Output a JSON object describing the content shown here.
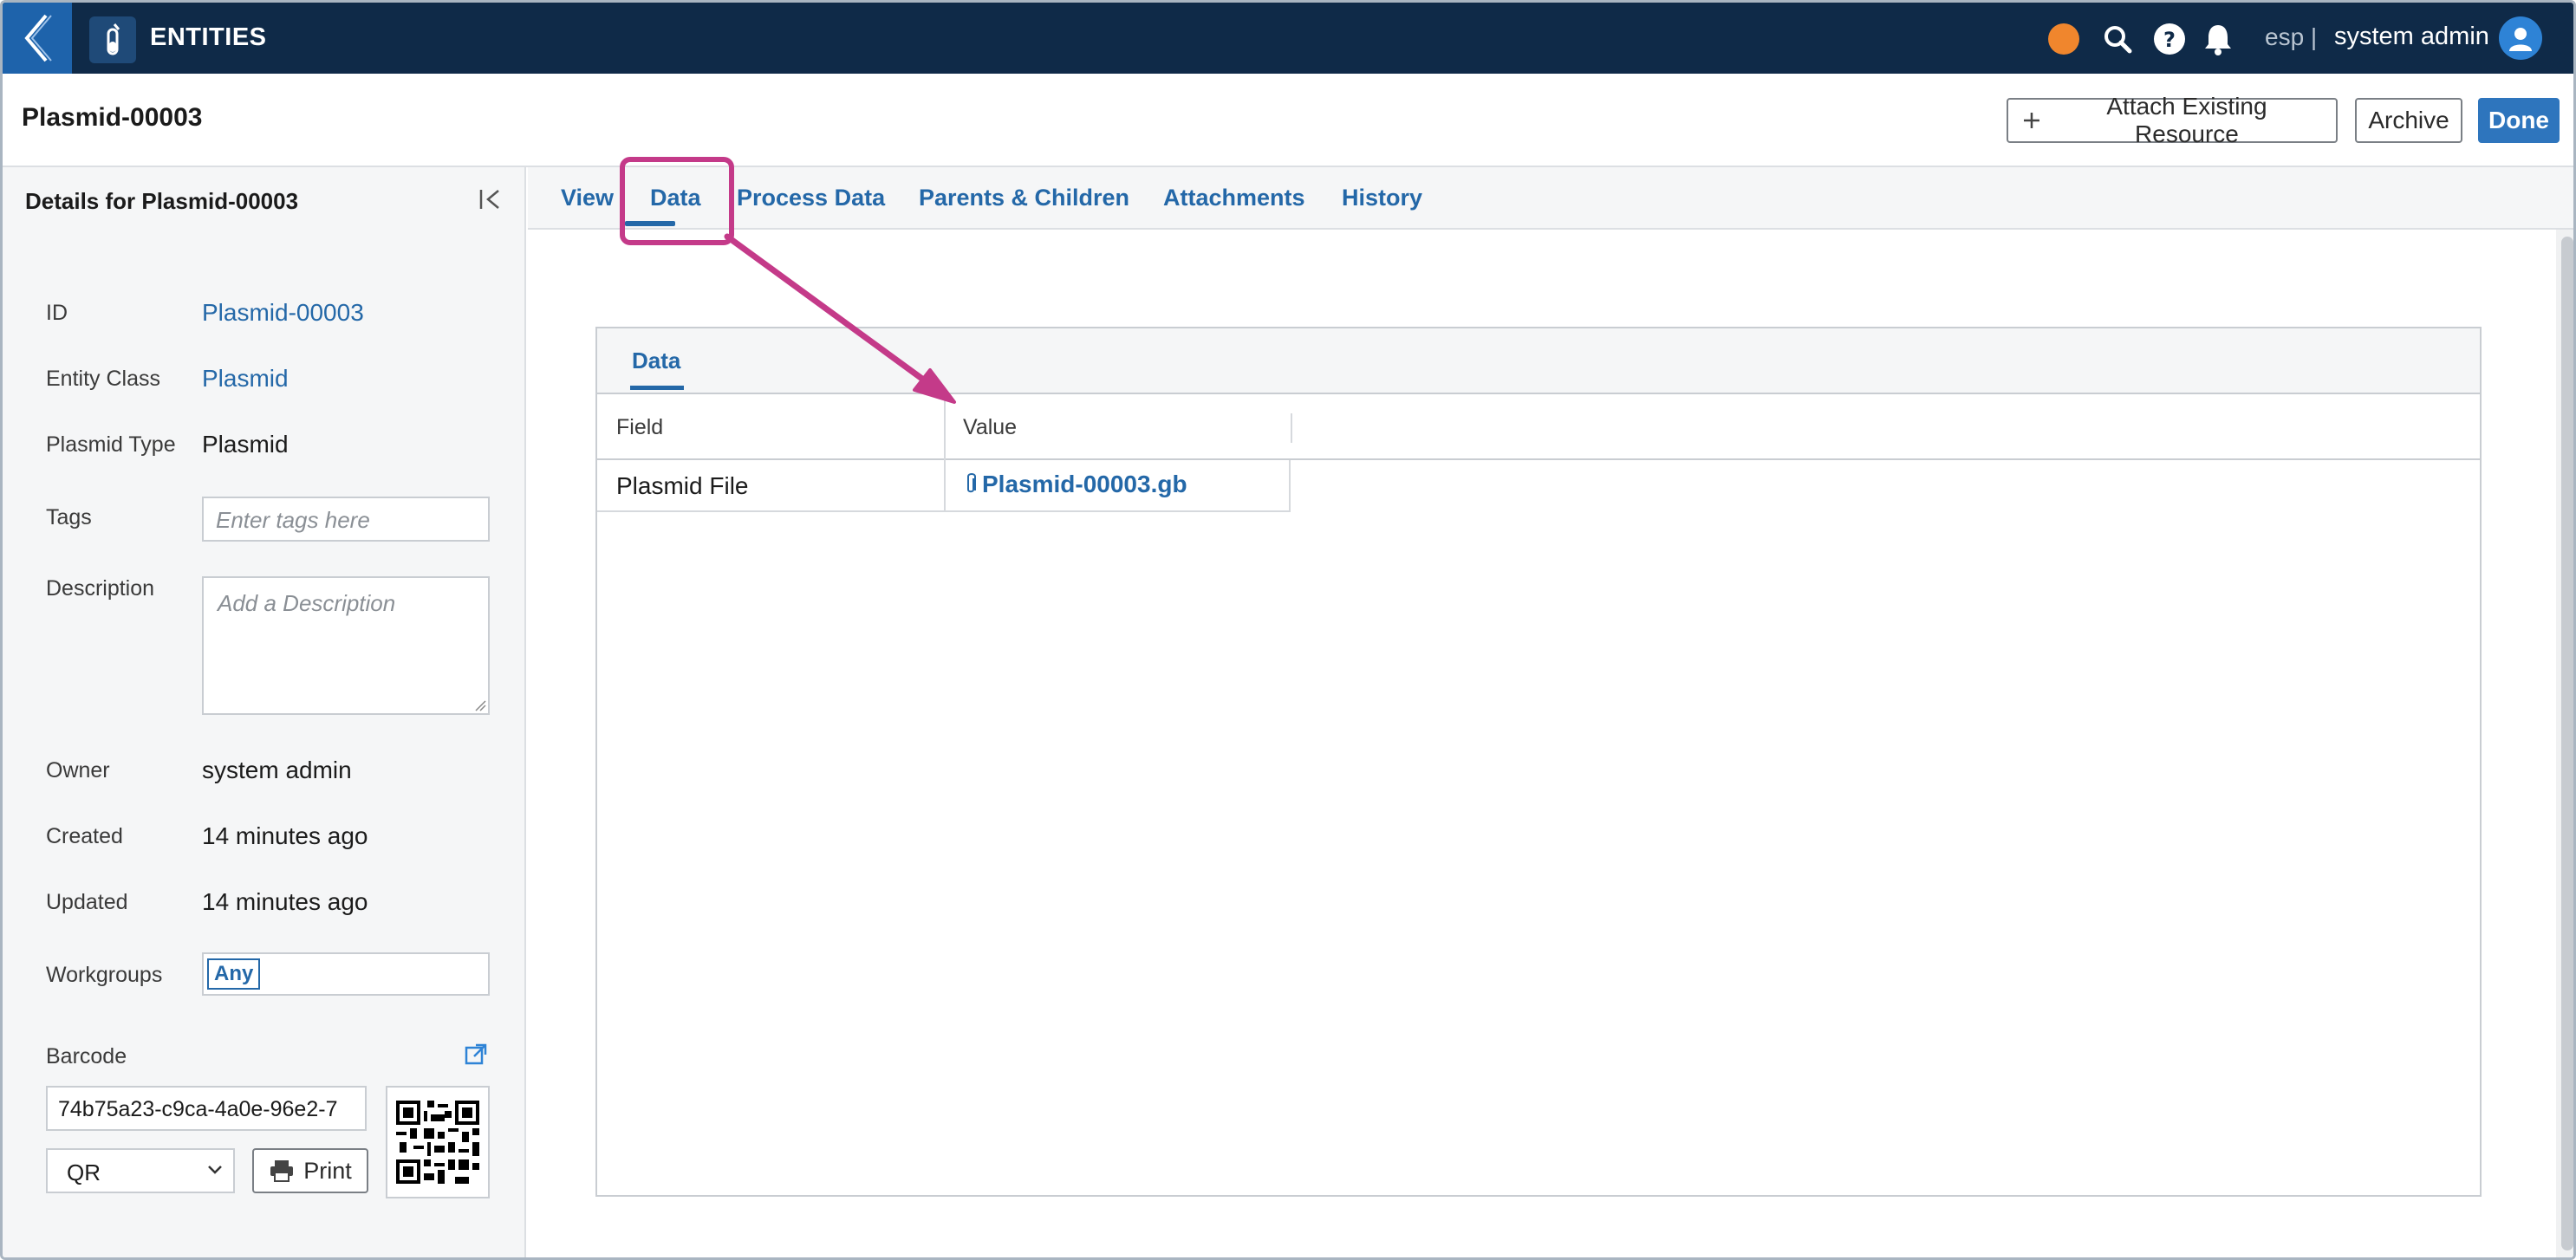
{
  "topbar": {
    "app_title": "ENTITIES",
    "tenant": "esp |",
    "user_name": "system admin",
    "icons": [
      "back-chevron-icon",
      "entity-tube-icon",
      "status-dot",
      "search-icon",
      "help-icon",
      "bell-icon",
      "user-avatar-icon"
    ],
    "status_color": "#f0862d"
  },
  "header": {
    "title": "Plasmid-00003",
    "attach_label": "Attach Existing Resource",
    "archive_label": "Archive",
    "done_label": "Done"
  },
  "sidebar": {
    "title": "Details for Plasmid-00003",
    "fields": {
      "id_label": "ID",
      "id_value": "Plasmid-00003",
      "class_label": "Entity Class",
      "class_value": "Plasmid",
      "type_label": "Plasmid Type",
      "type_value": "Plasmid",
      "tags_label": "Tags",
      "tags_placeholder": "Enter tags here",
      "description_label": "Description",
      "description_placeholder": "Add a Description",
      "owner_label": "Owner",
      "owner_value": "system admin",
      "created_label": "Created",
      "created_value": "14 minutes ago",
      "updated_label": "Updated",
      "updated_value": "14 minutes ago",
      "workgroups_label": "Workgroups",
      "workgroups_chip": "Any",
      "barcode_label": "Barcode",
      "barcode_value": "74b75a23-c9ca-4a0e-96e2-7",
      "barcode_type": "QR",
      "print_label": "Print"
    }
  },
  "tabs": [
    "View",
    "Data",
    "Process Data",
    "Parents & Children",
    "Attachments",
    "History"
  ],
  "active_tab": "Data",
  "data_panel": {
    "tab_label": "Data",
    "columns": [
      "Field",
      "Value"
    ],
    "rows": [
      {
        "field": "Plasmid File",
        "value": "Plasmid-00003.gb"
      }
    ]
  },
  "annotation": {
    "highlight_color": "#c43a89"
  },
  "colors": {
    "topbar_bg": "#0f2a48",
    "accent": "#2468a8",
    "primary_button": "#2e75bd"
  }
}
